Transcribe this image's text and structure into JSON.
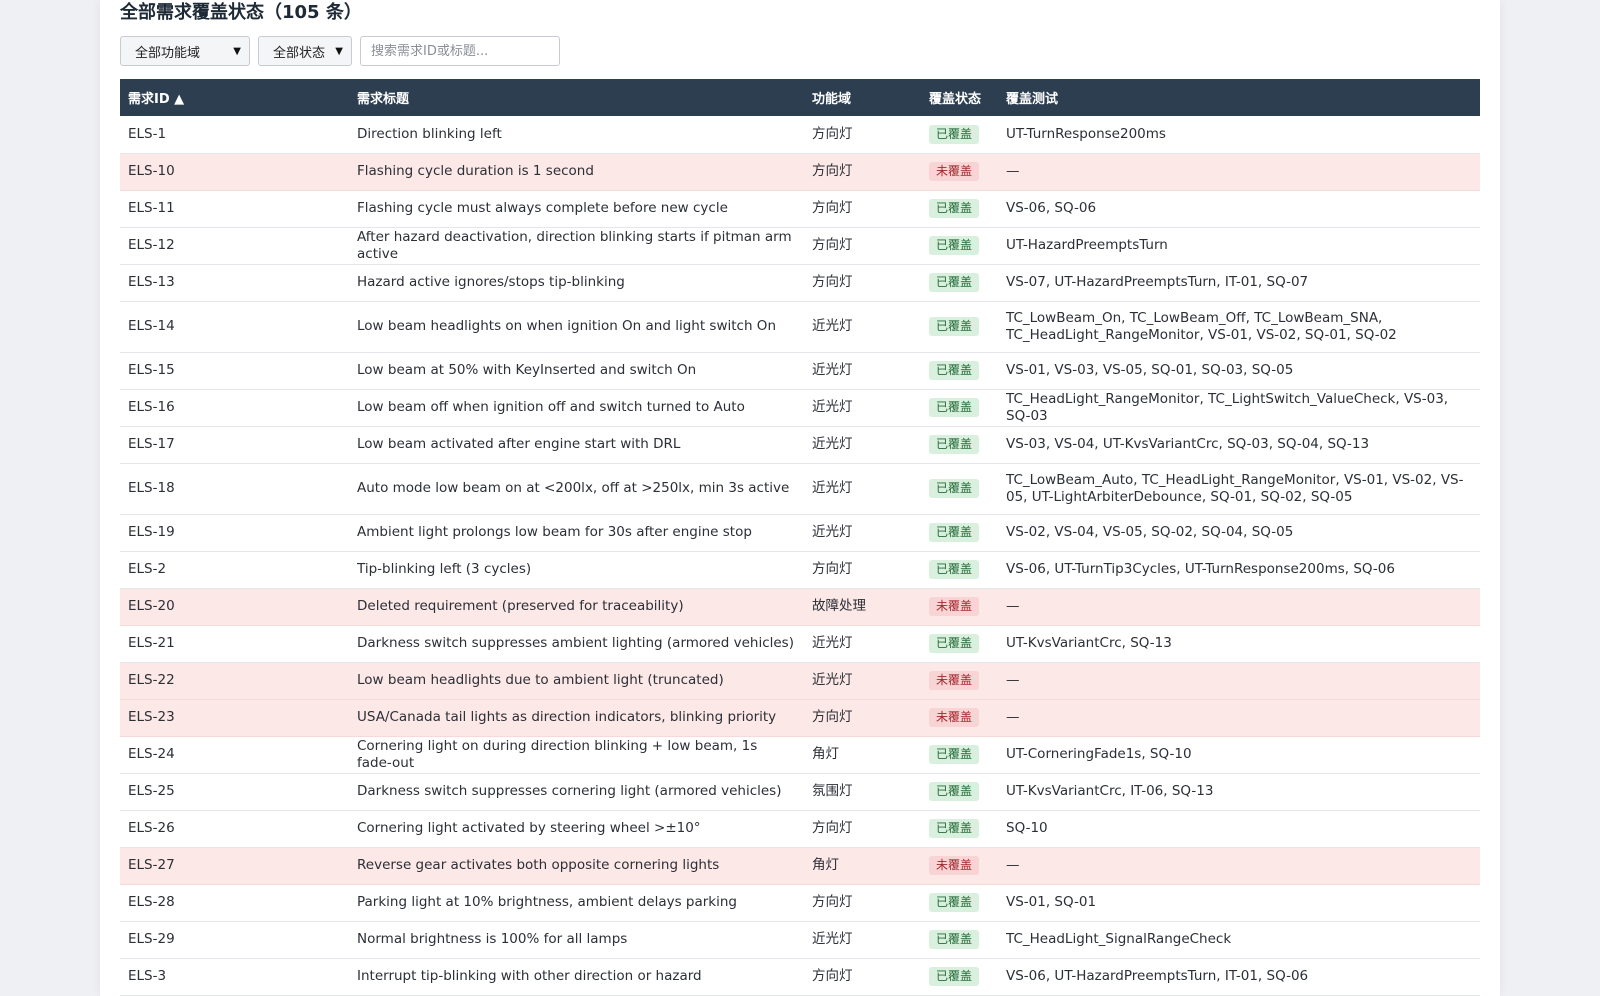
{
  "page_title": "全部需求覆盖状态（105 条）",
  "filters": {
    "domain_select": "全部功能域",
    "status_select": "全部状态",
    "search_placeholder": "搜索需求ID或标题..."
  },
  "colors": {
    "header_bg": "#2c3e50",
    "uncovered_row_bg": "#fde8e8",
    "covered_badge_bg": "#d8f0dd",
    "uncovered_badge_bg": "#f8d4d4"
  },
  "table": {
    "headers": {
      "id": "需求ID ▲",
      "title": "需求标题",
      "domain": "功能域",
      "status": "覆盖状态",
      "tests": "覆盖测试"
    },
    "rows": [
      {
        "id": "ELS-1",
        "title": "Direction blinking left",
        "domain": "方向灯",
        "status": "已覆盖",
        "covered": true,
        "tests": "UT-TurnResponse200ms"
      },
      {
        "id": "ELS-10",
        "title": "Flashing cycle duration is 1 second",
        "domain": "方向灯",
        "status": "未覆盖",
        "covered": false,
        "tests": "—"
      },
      {
        "id": "ELS-11",
        "title": "Flashing cycle must always complete before new cycle",
        "domain": "方向灯",
        "status": "已覆盖",
        "covered": true,
        "tests": "VS-06, SQ-06"
      },
      {
        "id": "ELS-12",
        "title": "After hazard deactivation, direction blinking starts if pitman arm active",
        "domain": "方向灯",
        "status": "已覆盖",
        "covered": true,
        "tests": "UT-HazardPreemptsTurn"
      },
      {
        "id": "ELS-13",
        "title": "Hazard active ignores/stops tip-blinking",
        "domain": "方向灯",
        "status": "已覆盖",
        "covered": true,
        "tests": "VS-07, UT-HazardPreemptsTurn, IT-01, SQ-07"
      },
      {
        "id": "ELS-14",
        "title": "Low beam headlights on when ignition On and light switch On",
        "domain": "近光灯",
        "status": "已覆盖",
        "covered": true,
        "tests": "TC_LowBeam_On, TC_LowBeam_Off, TC_LowBeam_SNA, TC_HeadLight_RangeMonitor, VS-01, VS-02, SQ-01, SQ-02",
        "tall": true
      },
      {
        "id": "ELS-15",
        "title": "Low beam at 50% with KeyInserted and switch On",
        "domain": "近光灯",
        "status": "已覆盖",
        "covered": true,
        "tests": "VS-01, VS-03, VS-05, SQ-01, SQ-03, SQ-05"
      },
      {
        "id": "ELS-16",
        "title": "Low beam off when ignition off and switch turned to Auto",
        "domain": "近光灯",
        "status": "已覆盖",
        "covered": true,
        "tests": "TC_HeadLight_RangeMonitor, TC_LightSwitch_ValueCheck, VS-03, SQ-03"
      },
      {
        "id": "ELS-17",
        "title": "Low beam activated after engine start with DRL",
        "domain": "近光灯",
        "status": "已覆盖",
        "covered": true,
        "tests": "VS-03, VS-04, UT-KvsVariantCrc, SQ-03, SQ-04, SQ-13"
      },
      {
        "id": "ELS-18",
        "title": "Auto mode low beam on at <200lx, off at >250lx, min 3s active",
        "domain": "近光灯",
        "status": "已覆盖",
        "covered": true,
        "tests": "TC_LowBeam_Auto, TC_HeadLight_RangeMonitor, VS-01, VS-02, VS-05, UT-LightArbiterDebounce, SQ-01, SQ-02, SQ-05",
        "tall": true
      },
      {
        "id": "ELS-19",
        "title": "Ambient light prolongs low beam for 30s after engine stop",
        "domain": "近光灯",
        "status": "已覆盖",
        "covered": true,
        "tests": "VS-02, VS-04, VS-05, SQ-02, SQ-04, SQ-05"
      },
      {
        "id": "ELS-2",
        "title": "Tip-blinking left (3 cycles)",
        "domain": "方向灯",
        "status": "已覆盖",
        "covered": true,
        "tests": "VS-06, UT-TurnTip3Cycles, UT-TurnResponse200ms, SQ-06"
      },
      {
        "id": "ELS-20",
        "title": "Deleted requirement (preserved for traceability)",
        "domain": "故障处理",
        "status": "未覆盖",
        "covered": false,
        "tests": "—"
      },
      {
        "id": "ELS-21",
        "title": "Darkness switch suppresses ambient lighting (armored vehicles)",
        "domain": "近光灯",
        "status": "已覆盖",
        "covered": true,
        "tests": "UT-KvsVariantCrc, SQ-13"
      },
      {
        "id": "ELS-22",
        "title": "Low beam headlights due to ambient light (truncated)",
        "domain": "近光灯",
        "status": "未覆盖",
        "covered": false,
        "tests": "—"
      },
      {
        "id": "ELS-23",
        "title": "USA/Canada tail lights as direction indicators, blinking priority",
        "domain": "方向灯",
        "status": "未覆盖",
        "covered": false,
        "tests": "—"
      },
      {
        "id": "ELS-24",
        "title": "Cornering light on during direction blinking + low beam, 1s fade-out",
        "domain": "角灯",
        "status": "已覆盖",
        "covered": true,
        "tests": "UT-CorneringFade1s, SQ-10"
      },
      {
        "id": "ELS-25",
        "title": "Darkness switch suppresses cornering light (armored vehicles)",
        "domain": "氛围灯",
        "status": "已覆盖",
        "covered": true,
        "tests": "UT-KvsVariantCrc, IT-06, SQ-13"
      },
      {
        "id": "ELS-26",
        "title": "Cornering light activated by steering wheel >±10°",
        "domain": "方向灯",
        "status": "已覆盖",
        "covered": true,
        "tests": "SQ-10"
      },
      {
        "id": "ELS-27",
        "title": "Reverse gear activates both opposite cornering lights",
        "domain": "角灯",
        "status": "未覆盖",
        "covered": false,
        "tests": "—"
      },
      {
        "id": "ELS-28",
        "title": "Parking light at 10% brightness, ambient delays parking",
        "domain": "方向灯",
        "status": "已覆盖",
        "covered": true,
        "tests": "VS-01, SQ-01"
      },
      {
        "id": "ELS-29",
        "title": "Normal brightness is 100% for all lamps",
        "domain": "近光灯",
        "status": "已覆盖",
        "covered": true,
        "tests": "TC_HeadLight_SignalRangeCheck"
      },
      {
        "id": "ELS-3",
        "title": "Interrupt tip-blinking with other direction or hazard",
        "domain": "方向灯",
        "status": "已覆盖",
        "covered": true,
        "tests": "VS-06, UT-HazardPreemptsTurn, IT-01, SQ-06"
      }
    ]
  }
}
